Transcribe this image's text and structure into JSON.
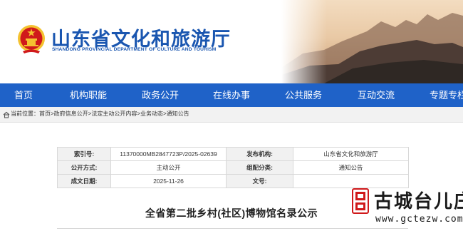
{
  "header": {
    "title": "山东省文化和旅游厅",
    "subtitle": "SHANDONG PROVINCIAL DEPARTMENT OF CULTURE AND  TOURISM"
  },
  "nav": {
    "items": [
      "首页",
      "机构职能",
      "政务公开",
      "在线办事",
      "公共服务",
      "互动交流",
      "专题专栏"
    ]
  },
  "breadcrumb": {
    "text": "当前位置：首页>政府信息公开>法定主动公开内容>业务动态>通知公告"
  },
  "info": {
    "index_label": "索引号:",
    "index_value": "11370000MB2847723P/2025-02639",
    "publisher_label": "发布机构:",
    "publisher_value": "山东省文化和旅游厅",
    "method_label": "公开方式:",
    "method_value": "主动公开",
    "category_label": "组配分类:",
    "category_value": "通知公告",
    "date_label": "成文日期:",
    "date_value": "2025-11-26",
    "docno_label": "文号:",
    "docno_value": ""
  },
  "document": {
    "title": "全省第二批乡村(社区)博物馆名录公示"
  },
  "watermark": {
    "text": "古城台儿庄",
    "url": "www.gctezw.com"
  },
  "colors": {
    "nav_blue": "#1f62c8",
    "title_blue": "#1a56b0",
    "emblem_red": "#d0191b",
    "emblem_gold": "#f4c230"
  },
  "icons": {
    "emblem": "national-emblem-icon",
    "home": "home-icon",
    "seal": "red-seal-icon"
  }
}
